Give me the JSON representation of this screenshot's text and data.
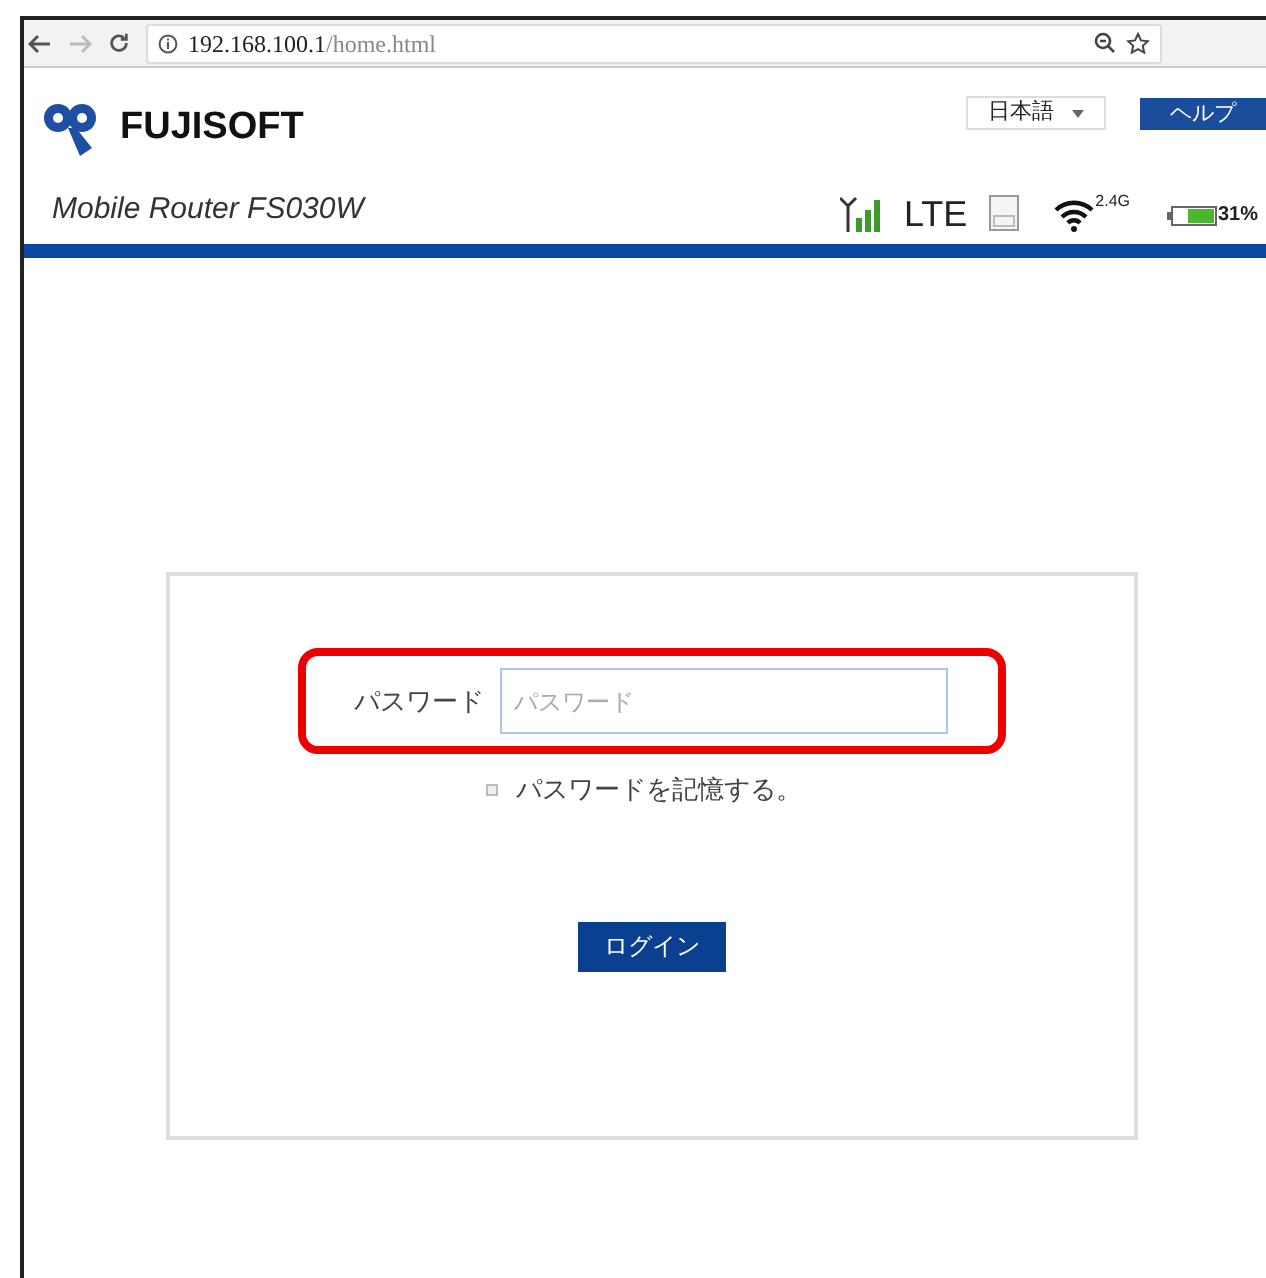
{
  "browser": {
    "url_host": "192.168.100.1",
    "url_path": "/home.html"
  },
  "header": {
    "brand": "FUJISOFT",
    "language": "日本語",
    "help": "ヘルプ",
    "product": "Mobile Router FS030W",
    "network": "LTE",
    "wifi_band": "2.4G",
    "battery": "31%"
  },
  "login": {
    "label": "パスワード",
    "placeholder": "パスワード",
    "remember": {
      "label": "パスワードを記憶する。",
      "checked": false
    },
    "button": "ログイン"
  }
}
